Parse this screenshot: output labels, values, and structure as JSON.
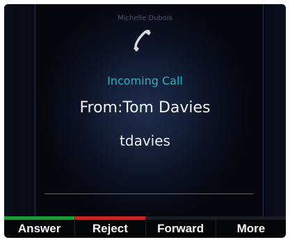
{
  "phone": {
    "line_owner": "Michelle Dubois",
    "status": "Incoming Call",
    "caller": "From:Tom Davies",
    "caller_id": "tdavies"
  },
  "softkeys": [
    {
      "label": "Answer",
      "color": "#1f9a3a"
    },
    {
      "label": "Reject",
      "color": "#c4262a"
    },
    {
      "label": "Forward"
    },
    {
      "label": "More"
    }
  ],
  "icons": {
    "call_status": "phone-handset-icon"
  },
  "colors": {
    "status_text": "#21b6c4",
    "background": "#0b1122"
  }
}
